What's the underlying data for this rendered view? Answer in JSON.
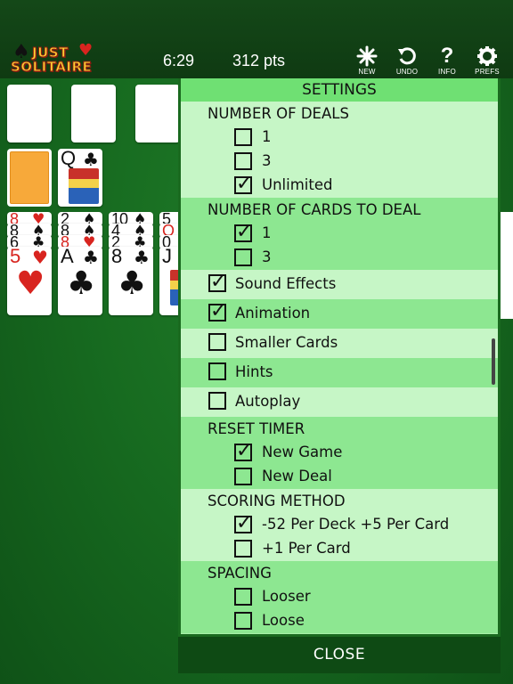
{
  "header": {
    "logo_line1": "JUST",
    "logo_line2": "SOLITAIRE",
    "time": "6:29",
    "score": "312 pts",
    "tools": [
      {
        "label": "NEW",
        "icon": "new-icon"
      },
      {
        "label": "UNDO",
        "icon": "undo-icon"
      },
      {
        "label": "INFO",
        "icon": "info-icon"
      },
      {
        "label": "PREFS",
        "icon": "gear-icon"
      }
    ]
  },
  "cards": {
    "waste": {
      "rank": "Q",
      "suit": "♣"
    },
    "tableau": [
      {
        "strips": [
          [
            "8",
            "♥",
            "red"
          ],
          [
            "8",
            "♠",
            "black"
          ],
          [
            "6",
            "♣",
            "black"
          ]
        ],
        "top": {
          "rank": "5",
          "suit": "♥",
          "color": "red"
        }
      },
      {
        "strips": [
          [
            "2",
            "♠",
            "black"
          ],
          [
            "8",
            "♠",
            "black"
          ],
          [
            "8",
            "♥",
            "red"
          ]
        ],
        "top": {
          "rank": "A",
          "suit": "♣",
          "color": "black"
        }
      },
      {
        "strips": [
          [
            "10",
            "♠",
            "black"
          ],
          [
            "4",
            "♠",
            "black"
          ],
          [
            "2",
            "♣",
            "black"
          ]
        ],
        "top": {
          "rank": "8",
          "suit": "♣",
          "color": "black"
        }
      },
      {
        "strips": [
          [
            "5",
            "",
            " black"
          ],
          [
            "Q",
            "",
            "red"
          ],
          [
            "0",
            "",
            "black"
          ]
        ],
        "top": {
          "rank": "J",
          "suit": "",
          "color": "black"
        }
      }
    ]
  },
  "settings": {
    "title": "SETTINGS",
    "number_of_deals": {
      "heading": "NUMBER OF DEALS",
      "options": [
        {
          "label": "1",
          "checked": false
        },
        {
          "label": "3",
          "checked": false
        },
        {
          "label": "Unlimited",
          "checked": true
        }
      ]
    },
    "cards_to_deal": {
      "heading": "NUMBER OF CARDS TO DEAL",
      "options": [
        {
          "label": "1",
          "checked": true
        },
        {
          "label": "3",
          "checked": false
        }
      ]
    },
    "toggles": [
      {
        "label": "Sound Effects",
        "checked": true
      },
      {
        "label": "Animation",
        "checked": true
      },
      {
        "label": "Smaller Cards",
        "checked": false
      },
      {
        "label": "Hints",
        "checked": false
      },
      {
        "label": "Autoplay",
        "checked": false
      }
    ],
    "reset_timer": {
      "heading": "RESET TIMER",
      "options": [
        {
          "label": "New Game",
          "checked": true
        },
        {
          "label": "New Deal",
          "checked": false
        }
      ]
    },
    "scoring": {
      "heading": "SCORING METHOD",
      "options": [
        {
          "label": "-52 Per Deck +5 Per Card",
          "checked": true
        },
        {
          "label": "+1 Per Card",
          "checked": false
        }
      ]
    },
    "spacing": {
      "heading": "SPACING",
      "options": [
        {
          "label": "Looser",
          "checked": false
        },
        {
          "label": "Loose",
          "checked": false
        }
      ]
    },
    "close_label": "CLOSE",
    "check_mark": "✓"
  }
}
